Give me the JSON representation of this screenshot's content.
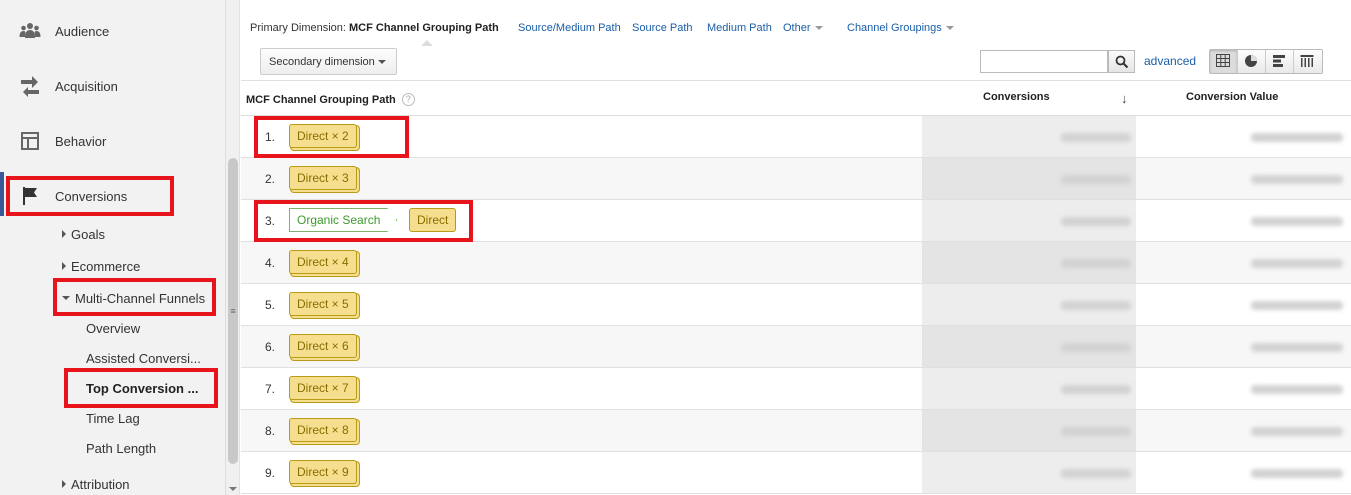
{
  "sidebar": {
    "main": [
      {
        "label": "Audience",
        "icon": "people-icon"
      },
      {
        "label": "Acquisition",
        "icon": "arrows-icon"
      },
      {
        "label": "Behavior",
        "icon": "layout-icon"
      },
      {
        "label": "Conversions",
        "icon": "flag-icon"
      }
    ],
    "sub": [
      {
        "label": "Goals"
      },
      {
        "label": "Ecommerce"
      },
      {
        "label": "Multi-Channel Funnels"
      },
      {
        "label": "Attribution"
      }
    ],
    "leaves": [
      {
        "label": "Overview"
      },
      {
        "label": "Assisted Conversi..."
      },
      {
        "label": "Top Conversion ..."
      },
      {
        "label": "Time Lag"
      },
      {
        "label": "Path Length"
      }
    ]
  },
  "dimension_bar": {
    "label": "Primary Dimension:",
    "current": "MCF Channel Grouping Path",
    "links": [
      "Source/Medium Path",
      "Source Path",
      "Medium Path",
      "Other",
      "Channel Groupings"
    ]
  },
  "toolbar": {
    "secondary_dimension": "Secondary dimension",
    "search_value": "",
    "advanced": "advanced"
  },
  "table": {
    "headers": {
      "path": "MCF Channel Grouping Path",
      "help": "?",
      "conversions": "Conversions",
      "sort_arrow": "↓",
      "value": "Conversion Value"
    },
    "rows": [
      {
        "num": "1.",
        "chips": [
          {
            "label": "Direct × 2",
            "type": "stack"
          }
        ]
      },
      {
        "num": "2.",
        "chips": [
          {
            "label": "Direct × 3",
            "type": "stack"
          }
        ]
      },
      {
        "num": "3.",
        "chips": [
          {
            "label": "Organic Search",
            "type": "green"
          },
          {
            "label": "Direct",
            "type": "single"
          }
        ]
      },
      {
        "num": "4.",
        "chips": [
          {
            "label": "Direct × 4",
            "type": "stack"
          }
        ]
      },
      {
        "num": "5.",
        "chips": [
          {
            "label": "Direct × 5",
            "type": "stack"
          }
        ]
      },
      {
        "num": "6.",
        "chips": [
          {
            "label": "Direct × 6",
            "type": "stack"
          }
        ]
      },
      {
        "num": "7.",
        "chips": [
          {
            "label": "Direct × 7",
            "type": "stack"
          }
        ]
      },
      {
        "num": "8.",
        "chips": [
          {
            "label": "Direct × 8",
            "type": "stack"
          }
        ]
      },
      {
        "num": "9.",
        "chips": [
          {
            "label": "Direct × 9",
            "type": "stack"
          }
        ]
      }
    ]
  },
  "colors": {
    "highlight": "#e8141c",
    "link": "#1a5ea8",
    "chip_fill": "#f5df8e",
    "chip_green": "#3b9b2b"
  }
}
